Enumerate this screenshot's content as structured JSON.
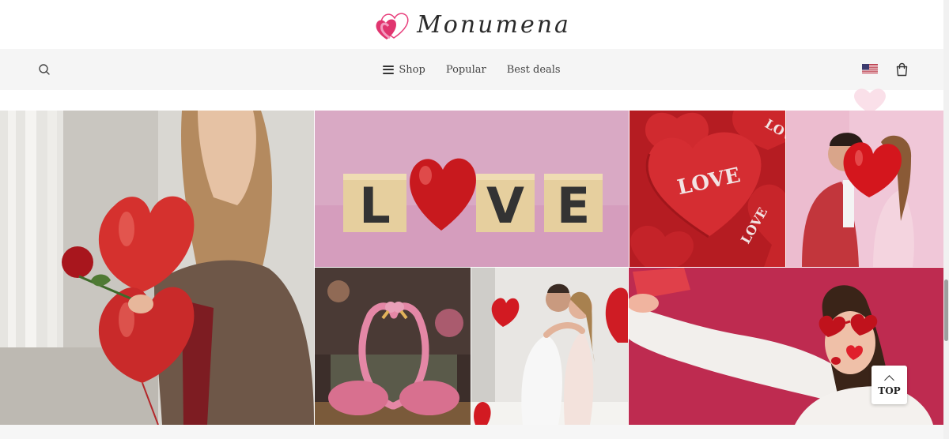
{
  "brand": {
    "name": "Monumena",
    "logo_icon": "double-heart-logo",
    "colors": {
      "heart_front": "#e0356f",
      "heart_back": "#f39bbf",
      "text": "#2a2a2a"
    }
  },
  "nav": {
    "search_icon": "search-icon",
    "items": [
      {
        "label": "Shop",
        "icon": "menu-icon"
      },
      {
        "label": "Popular"
      },
      {
        "label": "Best deals"
      }
    ],
    "flag_icon": "us-flag-icon",
    "cart_icon": "shopping-bag-icon"
  },
  "gallery": {
    "tiles": [
      {
        "name": "woman-with-heart-balloons",
        "icon": "photo"
      },
      {
        "name": "love-letter-blocks",
        "letters": [
          "L",
          "V",
          "E"
        ],
        "icon": "photo"
      },
      {
        "name": "plush-love-hearts",
        "text": "LOVE",
        "icon": "photo"
      },
      {
        "name": "couple-kissing-behind-balloon",
        "icon": "photo"
      },
      {
        "name": "pink-flamingos-heart",
        "icon": "photo"
      },
      {
        "name": "couple-hugging",
        "icon": "photo"
      },
      {
        "name": "woman-selfie-heart-glasses",
        "icon": "photo"
      }
    ]
  },
  "back_to_top": {
    "label": "TOP",
    "icon": "chevron-up-icon"
  }
}
